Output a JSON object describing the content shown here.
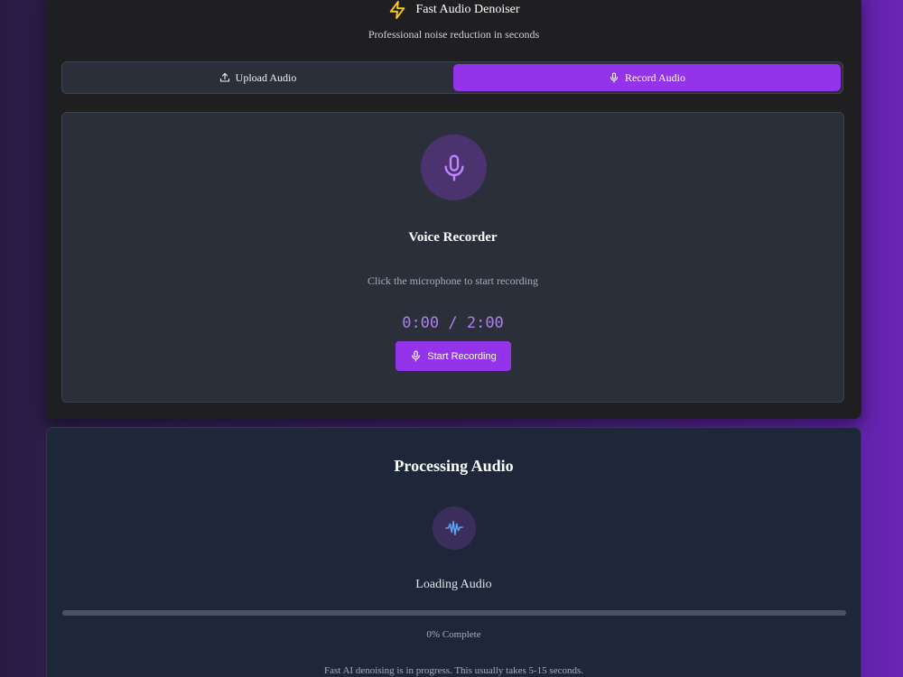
{
  "header": {
    "title": "Fast Audio Denoiser",
    "subtitle": "Professional noise reduction in seconds",
    "icon": "lightning-bolt-icon"
  },
  "tabs": [
    {
      "label": "Upload Audio",
      "icon": "upload-icon",
      "active": false
    },
    {
      "label": "Record Audio",
      "icon": "microphone-icon",
      "active": true
    }
  ],
  "recorder": {
    "title": "Voice Recorder",
    "hint": "Click the microphone to start recording",
    "timer": "0:00 / 2:00",
    "start_button": "Start Recording"
  },
  "processing": {
    "title": "Processing Audio",
    "stage": "Loading Audio",
    "progress_percent": 0,
    "progress_text": "0% Complete",
    "note": "Fast AI denoising is in progress. This usually takes 5-15 seconds."
  },
  "colors": {
    "accent": "#9333ea",
    "bolt": "#facc15",
    "timer": "#b27df0",
    "wave": "#60a5fa"
  }
}
